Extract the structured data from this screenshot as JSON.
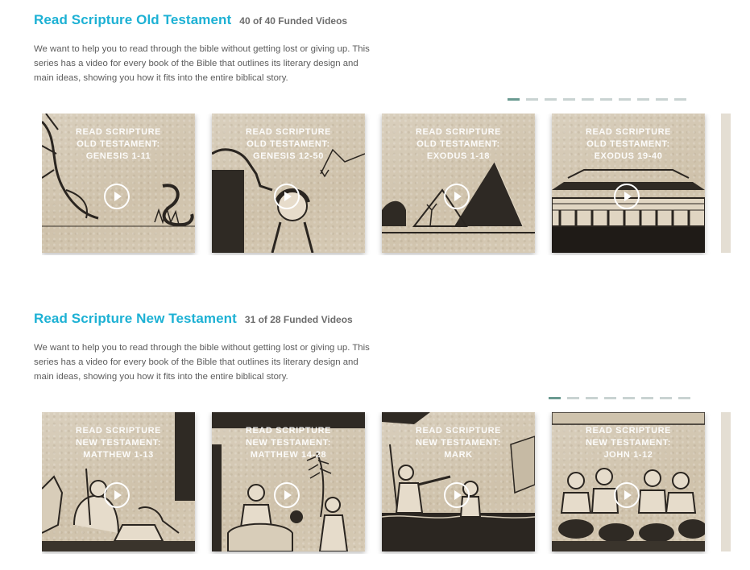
{
  "sections": [
    {
      "title": "Read Scripture Old Testament",
      "funded": "40 of 40 Funded Videos",
      "description": "We want to help you to read through the bible without getting lost or giving up. This series has a video for every book of the Bible that outlines its literary design and main ideas, showing you how it fits into the entire biblical story.",
      "pager_active": 0,
      "pager_count": 10,
      "cards": [
        {
          "line1": "READ SCRIPTURE",
          "line2": "OLD TESTAMENT:",
          "line3": "GENESIS 1-11",
          "art": "tree-snake-illustration"
        },
        {
          "line1": "READ SCRIPTURE",
          "line2": "OLD TESTAMENT:",
          "line3": "GENESIS 12-50",
          "art": "camel-travelers-illustration"
        },
        {
          "line1": "READ SCRIPTURE",
          "line2": "OLD TESTAMENT:",
          "line3": "EXODUS 1-18",
          "art": "pyramids-illustration"
        },
        {
          "line1": "READ SCRIPTURE",
          "line2": "OLD TESTAMENT:",
          "line3": "EXODUS 19-40",
          "art": "tabernacle-illustration"
        }
      ]
    },
    {
      "title": "Read Scripture New Testament",
      "funded": "31 of 28 Funded Videos",
      "description": "We want to help you to read through the bible without getting lost or giving up. This series has a video for every book of the Bible that outlines its literary design and main ideas, showing you how it fits into the entire biblical story.",
      "pager_active": 0,
      "pager_count": 8,
      "cards": [
        {
          "line1": "READ SCRIPTURE",
          "line2": "NEW TESTAMENT:",
          "line3": "MATTHEW 1-13",
          "art": "nativity-illustration"
        },
        {
          "line1": "READ SCRIPTURE",
          "line2": "NEW TESTAMENT:",
          "line3": "MATTHEW 14-28",
          "art": "palm-entry-illustration"
        },
        {
          "line1": "READ SCRIPTURE",
          "line2": "NEW TESTAMENT:",
          "line3": "MARK",
          "art": "baptism-illustration"
        },
        {
          "line1": "READ SCRIPTURE",
          "line2": "NEW TESTAMENT:",
          "line3": "JOHN 1-12",
          "art": "wedding-jars-illustration"
        }
      ]
    }
  ],
  "icons": {
    "play": "play-icon"
  }
}
